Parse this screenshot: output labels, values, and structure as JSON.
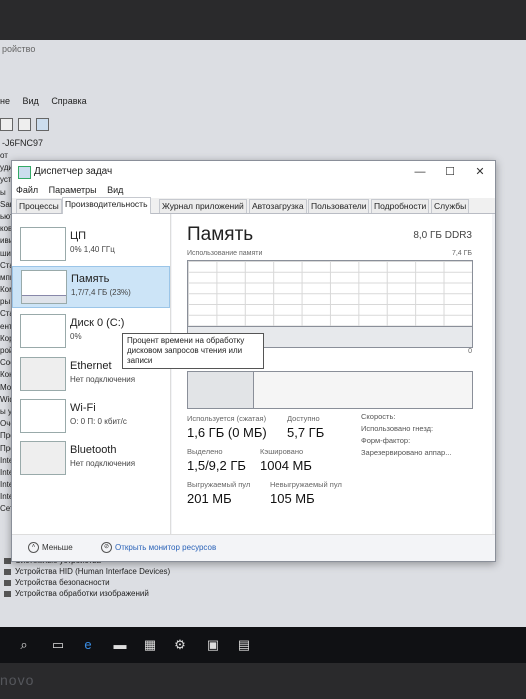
{
  "background_window": {
    "title": "ройство",
    "menu": [
      "не",
      "Вид",
      "Справка"
    ],
    "computer_name": "-J6FNC97",
    "tree_left": [
      "от",
      "удио",
      "уст",
      "ы",
      "SanD",
      "ьюте",
      "ковы",
      "ивиат",
      "ши и",
      "Стан",
      "мпьютеры",
      "Комп",
      "ры и",
      "Стан",
      "ентролл",
      "Корн",
      "рой",
      "Сост",
      "Контрол",
      "Монито",
      "Wide",
      "ы ут",
      "Очеред",
      "Програ",
      "Процес",
      "Intel",
      "Intel",
      "Intel",
      "Intel",
      "Сетевые"
    ],
    "tree_bottom": [
      "Системные устройства",
      "Устройства HID (Human Interface Devices)",
      "Устройства безопасности",
      "Устройства обработки изображений"
    ]
  },
  "task_manager": {
    "title": "Диспетчер задач",
    "menu": [
      "Файл",
      "Параметры",
      "Вид"
    ],
    "window_buttons": {
      "minimize": "—",
      "maximize": "☐",
      "close": "✕"
    },
    "tabs": [
      "Процессы",
      "Производительность",
      "Журнал приложений",
      "Автозагрузка",
      "Пользователи",
      "Подробности",
      "Службы"
    ],
    "active_tab": 1,
    "sidebar": [
      {
        "name": "ЦП",
        "sub": "0% 1,40 ГГц"
      },
      {
        "name": "Память",
        "sub": "1,7/7,4 ГБ (23%)"
      },
      {
        "name": "Диск 0 (C:)",
        "sub": "0%"
      },
      {
        "name": "Ethernet",
        "sub": "Нет подключения"
      },
      {
        "name": "Wi-Fi",
        "sub": "О: 0 П: 0 кбит/с"
      },
      {
        "name": "Bluetooth",
        "sub": "Нет подключения"
      }
    ],
    "selected_sidebar_index": 1,
    "tooltip": "Процент времени на обработку дисковом запросов чтения или записи",
    "memory": {
      "title": "Память",
      "total": "8,0 ГБ DDR3",
      "graph_label": "Использование памяти",
      "graph_max": "7,4 ГБ",
      "graph_min": "0",
      "usage_fraction": 0.23,
      "in_use_label": "Используется (сжатая)",
      "in_use_value": "1,6 ГБ (0 МБ)",
      "available_label": "Доступно",
      "available_value": "5,7 ГБ",
      "committed_label": "Выделено",
      "committed_value": "1,5/9,2 ГБ",
      "cached_label": "Кэшировано",
      "cached_value": "1004 МБ",
      "paged_label": "Выгружаемый пул",
      "paged_value": "201 МБ",
      "nonpaged_label": "Невыгружаемый пул",
      "nonpaged_value": "105 МБ",
      "speed_label": "Скорость:",
      "slots_label": "Использовано гнезд:",
      "form_label": "Форм-фактор:",
      "reserved_label": "Зарезервировано аппар..."
    },
    "footer": {
      "fewer": "Меньше",
      "monitor": "Открыть монитор ресурсов"
    }
  },
  "bezel": {
    "logo": "novo"
  },
  "colors": {
    "selected": "#cce4f7",
    "link": "#2b63b8"
  }
}
